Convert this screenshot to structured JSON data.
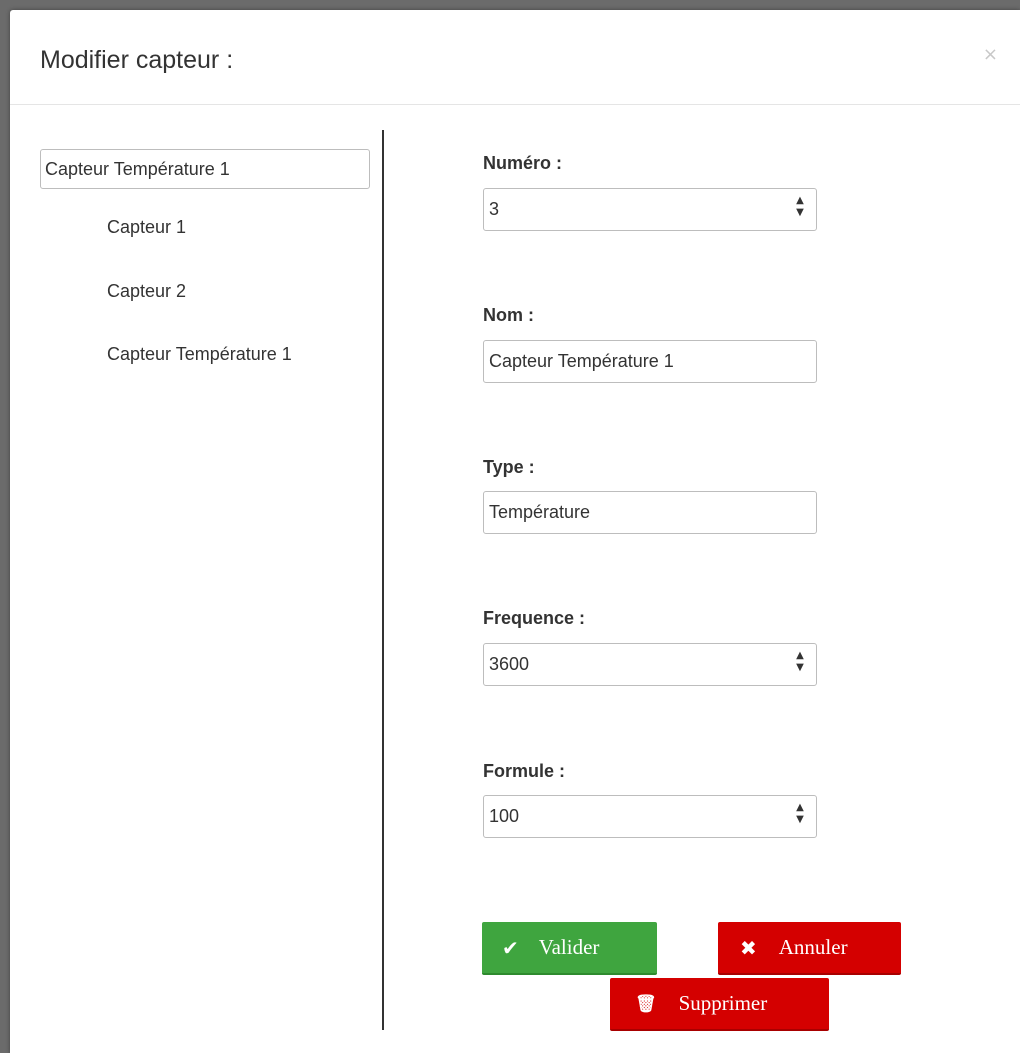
{
  "modal": {
    "title": "Modifier capteur :",
    "close_label": "×"
  },
  "tree": {
    "root_label": "Capteur Température 1",
    "children": [
      "Capteur 1",
      "Capteur 2",
      "Capteur Température 1"
    ]
  },
  "form": {
    "numero": {
      "label": "Numéro :",
      "value": "3"
    },
    "nom": {
      "label": "Nom :",
      "value": "Capteur Température 1"
    },
    "type": {
      "label": "Type :",
      "value": "Température"
    },
    "frequence": {
      "label": "Frequence :",
      "value": "3600"
    },
    "formule": {
      "label": "Formule :",
      "value": "100"
    }
  },
  "buttons": {
    "valider": {
      "label": "Valider",
      "icon": "check-icon",
      "glyph": "✔"
    },
    "annuler": {
      "label": "Annuler",
      "icon": "close-icon",
      "glyph": "✖"
    },
    "supprimer": {
      "label": "Supprimer",
      "icon": "trash-icon",
      "glyph": "🗑"
    }
  },
  "colors": {
    "success": "#3fa53f",
    "danger": "#d40000"
  }
}
